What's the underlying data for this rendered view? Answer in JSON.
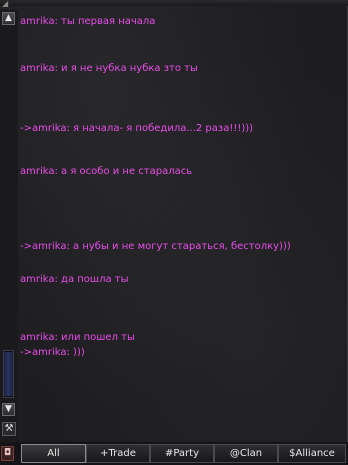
{
  "chat": {
    "messages": [
      {
        "text": "amrika:  ты первая начала"
      },
      {
        "text": "amrika: и я не нубка нубка зто ты"
      },
      {
        "text": "->amrika: я начала- я победила...2 раза!!!)))"
      },
      {
        "text": "amrika:  а я особо и не старалась"
      },
      {
        "text": "->amrika: а нубы и не могут стараться, бестолку)))"
      },
      {
        "text": "amrika: да пошла ты"
      },
      {
        "text": "amrika: или пошел ты"
      },
      {
        "text": "->amrika: )))"
      }
    ],
    "text_color": "#e84de8"
  },
  "controls": {
    "scroll_up_icon": "arrow-up-icon",
    "scroll_down_icon": "arrow-down-icon",
    "settings_icon": "tool-icon",
    "bag_icon": "bag-icon"
  },
  "tabs": [
    {
      "label": "All",
      "active": true
    },
    {
      "label": "+Trade",
      "active": false
    },
    {
      "label": "#Party",
      "active": false
    },
    {
      "label": "@Clan",
      "active": false
    },
    {
      "label": "$Alliance",
      "active": false
    }
  ]
}
